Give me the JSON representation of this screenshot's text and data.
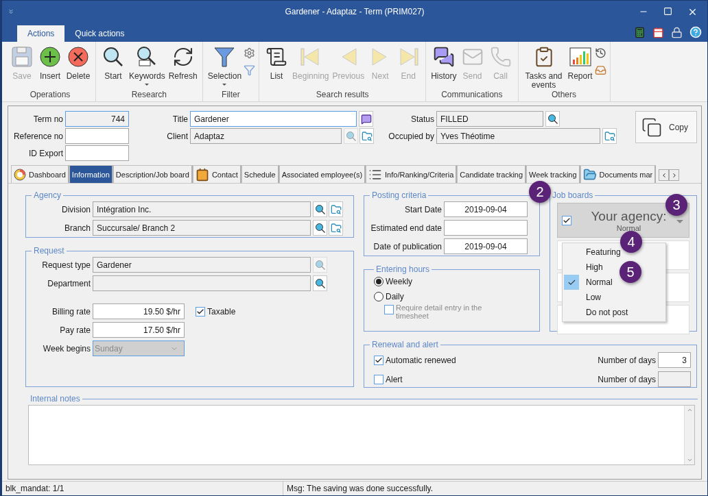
{
  "window": {
    "title": "Gardener - Adaptaz - Term (PRIM027)"
  },
  "ribbon_tabs": [
    {
      "label": "Actions",
      "selected": true
    },
    {
      "label": "Quick actions",
      "selected": false
    }
  ],
  "ribbon_groups": [
    {
      "label": "Operations",
      "buttons": [
        {
          "kind": "save",
          "label": "Save",
          "disabled": true
        },
        {
          "kind": "insert",
          "label": "Insert",
          "disabled": false
        },
        {
          "kind": "delete",
          "label": "Delete",
          "disabled": false
        }
      ]
    },
    {
      "label": "Research",
      "buttons": [
        {
          "kind": "start",
          "label": "Start",
          "disabled": false
        },
        {
          "kind": "keywords",
          "label": "Keywords",
          "disabled": false,
          "dropdown": true
        },
        {
          "kind": "refresh",
          "label": "Refresh",
          "disabled": false
        }
      ]
    },
    {
      "label": "Filter",
      "buttons": [
        {
          "kind": "selection",
          "label": "Selection",
          "disabled": false,
          "dropdown": true
        },
        {
          "kind": "mini-filter"
        }
      ]
    },
    {
      "label": "Search results",
      "buttons": [
        {
          "kind": "list",
          "label": "List",
          "disabled": false
        },
        {
          "kind": "beginning",
          "label": "Beginning",
          "disabled": true
        },
        {
          "kind": "previous",
          "label": "Previous",
          "disabled": true
        },
        {
          "kind": "next",
          "label": "Next",
          "disabled": true
        },
        {
          "kind": "end",
          "label": "End",
          "disabled": true
        }
      ]
    },
    {
      "label": "Communications",
      "buttons": [
        {
          "kind": "history",
          "label": "History",
          "disabled": false
        },
        {
          "kind": "send",
          "label": "Send",
          "disabled": true
        },
        {
          "kind": "call",
          "label": "Call",
          "disabled": true
        }
      ]
    },
    {
      "label": "Others",
      "buttons": [
        {
          "kind": "tasks",
          "label": "Tasks and events",
          "disabled": false
        },
        {
          "kind": "report",
          "label": "Report",
          "disabled": false
        },
        {
          "kind": "mini-others"
        }
      ]
    }
  ],
  "header": {
    "left": [
      {
        "label": "Term no",
        "value": "744",
        "readonly": true
      },
      {
        "label": "Reference no",
        "readonly": false
      },
      {
        "label": "ID Export",
        "readonly": false
      }
    ],
    "middle": [
      {
        "label": "Title",
        "value": "Gardener",
        "readonly": false,
        "buttons": [
          {
            "kind": "note",
            "disabled": false
          }
        ]
      },
      {
        "label": "Client",
        "value": "Adaptaz",
        "readonly": true,
        "buttons": [
          {
            "kind": "search",
            "disabled": true
          },
          {
            "kind": "folder",
            "disabled": false
          }
        ]
      }
    ],
    "right": [
      {
        "label": "Status",
        "value": "FILLED",
        "readonly": true,
        "buttons": [
          {
            "kind": "search",
            "disabled": false
          }
        ]
      },
      {
        "label": "Occupied by",
        "value": "Yves Théotime",
        "readonly": true,
        "buttons": [
          {
            "kind": "folder",
            "disabled": false
          }
        ]
      }
    ],
    "copy_button": {
      "label": "Copy"
    }
  },
  "tabs": [
    {
      "label": "Dashboard",
      "kind": "dashboard",
      "selected": false
    },
    {
      "label": "Information",
      "kind": "plain",
      "selected": true
    },
    {
      "label": "Description/Job board",
      "kind": "plain",
      "selected": false
    },
    {
      "label": "Contact",
      "kind": "contact",
      "selected": false
    },
    {
      "label": "Schedule",
      "kind": "plain",
      "selected": false
    },
    {
      "label": "Associated employee(s)",
      "kind": "plain",
      "selected": false
    },
    {
      "label": "Info/Ranking/Criteria",
      "kind": "ranking",
      "selected": false
    },
    {
      "label": "Candidate tracking",
      "kind": "plain",
      "selected": false
    },
    {
      "label": "Week tracking",
      "kind": "plain",
      "selected": false
    },
    {
      "label": "Documents mar",
      "kind": "documents",
      "selected": false
    }
  ],
  "agency": {
    "title": "Agency",
    "fields": [
      {
        "label": "Division",
        "value": "Intégration Inc.",
        "buttons": [
          {
            "kind": "search",
            "disabled": false
          },
          {
            "kind": "folder",
            "disabled": false
          }
        ]
      },
      {
        "label": "Branch",
        "value": "Succursale/ Branch 2",
        "buttons": [
          {
            "kind": "search",
            "disabled": false
          },
          {
            "kind": "folder",
            "disabled": false
          }
        ]
      }
    ]
  },
  "request": {
    "title": "Request",
    "fields": [
      {
        "label": "Request type",
        "value": "Gardener",
        "buttons": [
          {
            "kind": "search",
            "disabled": true
          }
        ]
      },
      {
        "label": "Department",
        "buttons": [
          {
            "kind": "search",
            "disabled": false
          }
        ]
      }
    ],
    "rates": [
      {
        "label": "Billing rate",
        "value": "19.50 $/hr"
      },
      {
        "label": "Pay rate",
        "value": "17.50 $/hr"
      }
    ],
    "taxable": {
      "label": "Taxable",
      "checked": true
    },
    "week_begins": {
      "label": "Week begins",
      "value": "Sunday",
      "disabled": true
    }
  },
  "posting_criteria": {
    "title": "Posting criteria",
    "fields": [
      {
        "label": "Start Date",
        "value": "2019-09-04"
      },
      {
        "label": "Estimated end date"
      },
      {
        "label": "Date of publication",
        "value": "2019-09-04"
      }
    ]
  },
  "entering_hours": {
    "title": "Entering hours",
    "options": [
      {
        "label": "Weekly",
        "selected": true
      },
      {
        "label": "Daily",
        "selected": false
      }
    ],
    "detail_entry": {
      "label": "Require detail entry in the timesheet",
      "checked": false,
      "disabled": true
    }
  },
  "job_boards": {
    "title": "Job boards",
    "agency": {
      "label": "Your agency:",
      "priority": "Normal",
      "checked": true
    },
    "priority_menu": [
      {
        "label": "Featuring",
        "selected": false
      },
      {
        "label": "High",
        "selected": false
      },
      {
        "label": "Normal",
        "selected": true
      },
      {
        "label": "Low",
        "selected": false
      },
      {
        "label": "Do not post",
        "selected": false
      }
    ]
  },
  "renewal": {
    "title": "Renewal and alert",
    "options": [
      {
        "label": "Automatic renewed",
        "checked": true,
        "days_label": "Number of days",
        "days": "3",
        "disabled": false
      },
      {
        "label": "Alert",
        "checked": false,
        "days_label": "Number of days",
        "disabled": true
      }
    ]
  },
  "internal_notes": {
    "title": "Internal notes"
  },
  "status_bar": [
    "blk_mandat: 1/1",
    "Msg: The saving was done successfully."
  ],
  "callouts": [
    "2",
    "3",
    "4",
    "5"
  ]
}
